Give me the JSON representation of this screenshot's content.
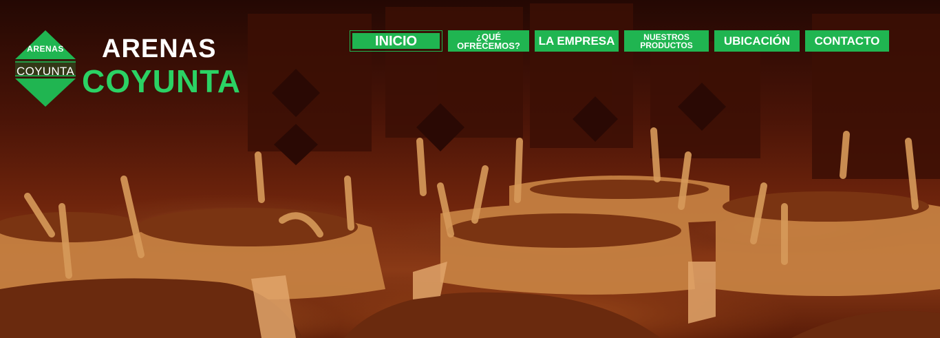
{
  "brand": {
    "emblem_top": "ARENAS",
    "emblem_bottom": "COYUNTA",
    "name_line1": "ARENAS",
    "name_line2": "COYUNTA"
  },
  "nav": {
    "items": [
      {
        "label": "INICIO",
        "active": true
      },
      {
        "label": "¿QUÉ OFRECEMOS?",
        "active": false
      },
      {
        "label": "LA EMPRESA",
        "active": false
      },
      {
        "label": "NUESTROS PRODUCTOS",
        "active": false
      },
      {
        "label": "UBICACIÓN",
        "active": false
      },
      {
        "label": "CONTACTO",
        "active": false
      }
    ]
  },
  "hero": {
    "subject": "sand-bags-photo"
  },
  "colors": {
    "accent_green": "#20b551",
    "brand_green_text": "#2bd264",
    "photo_tint": "#8a3a16"
  }
}
